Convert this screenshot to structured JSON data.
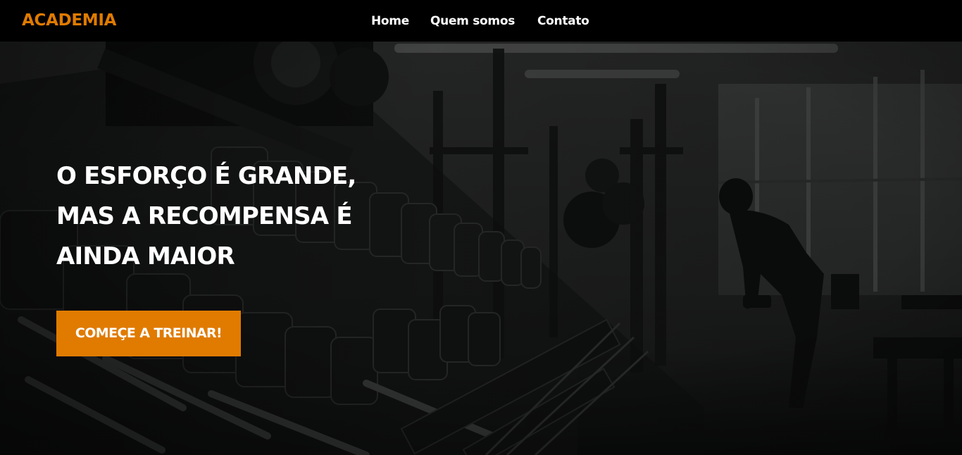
{
  "brand": {
    "logo_text": "ACADEMIA",
    "accent_color": "#e07b00"
  },
  "nav": {
    "items": [
      {
        "label": "Home"
      },
      {
        "label": "Quem somos"
      },
      {
        "label": "Contato"
      }
    ]
  },
  "hero": {
    "headline_lines": [
      "O ESFORÇO É GRANDE,",
      "MAS A RECOMPENSA É",
      "AINDA MAIOR"
    ],
    "cta_label": "COMEÇE A TREINAR!",
    "background_description_icon": "gym-dumbbell-rack-photo"
  }
}
